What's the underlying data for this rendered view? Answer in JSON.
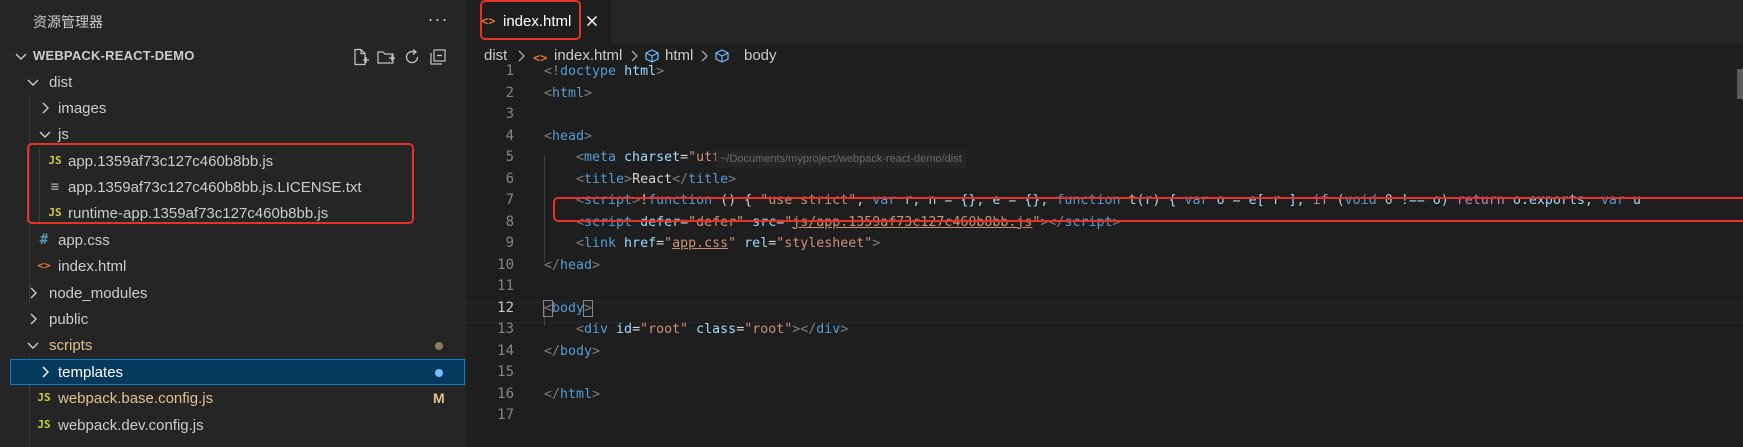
{
  "sidebar": {
    "title": "资源管理器",
    "more_label": "···",
    "section": "WEBPACK-REACT-DEMO",
    "tree": [
      {
        "name": "dist",
        "type": "folder",
        "expanded": true,
        "color": "#cccccc"
      },
      {
        "name": "images",
        "type": "folder",
        "expanded": false,
        "color": "#cccccc"
      },
      {
        "name": "js",
        "type": "folder",
        "expanded": true,
        "color": "#cccccc"
      },
      {
        "name": "app.1359af73c127c460b8bb.js",
        "type": "js",
        "icon": "JS",
        "color": "#cccccc"
      },
      {
        "name": "app.1359af73c127c460b8bb.js.LICENSE.txt",
        "type": "txt",
        "icon": "≡",
        "color": "#cccccc"
      },
      {
        "name": "runtime-app.1359af73c127c460b8bb.js",
        "type": "js",
        "icon": "JS",
        "color": "#cccccc"
      },
      {
        "name": "app.css",
        "type": "css",
        "icon": "#",
        "color": "#cccccc"
      },
      {
        "name": "index.html",
        "type": "html",
        "icon": "<>",
        "color": "#cccccc"
      },
      {
        "name": "node_modules",
        "type": "folder",
        "expanded": false,
        "color": "#cccccc"
      },
      {
        "name": "public",
        "type": "folder",
        "expanded": false,
        "color": "#cccccc"
      },
      {
        "name": "scripts",
        "type": "folder",
        "expanded": true,
        "color": "#e2c08d"
      },
      {
        "name": "templates",
        "type": "folder",
        "expanded": false,
        "color": "#ffffff"
      },
      {
        "name": "webpack.base.config.js",
        "type": "js",
        "icon": "JS",
        "color": "#e2c08d",
        "badge": "M"
      },
      {
        "name": "webpack.dev.config.js",
        "type": "js",
        "icon": "JS",
        "color": "#cccccc"
      }
    ]
  },
  "editor": {
    "tab_label": "index.html",
    "tab_icon": "<>",
    "breadcrumb": {
      "folder": "dist",
      "file": "index.html",
      "el1": "html",
      "el2": "body"
    },
    "path_hint": "~/Documents/myproject/webpack-react-demo/dist",
    "active_line": 12,
    "line_numbers": [
      "1",
      "2",
      "3",
      "4",
      "5",
      "6",
      "7",
      "8",
      "9",
      "10",
      "11",
      "12",
      "13",
      "14",
      "15",
      "16",
      "17"
    ],
    "code": {
      "l1": {
        "a": "<!",
        "b": "doctype",
        "c": " html",
        "d": ">"
      },
      "l2": {
        "a": "<",
        "b": "html",
        "c": ">"
      },
      "l4": {
        "a": "<",
        "b": "head",
        "c": ">"
      },
      "l5": {
        "a": "<",
        "b": "meta",
        "c": " charset",
        "d": "=",
        "e": "\"utf-8\"",
        "f": " />"
      },
      "l6": {
        "a": "<",
        "b": "title",
        "c": ">",
        "d": "React",
        "e": "</",
        "f": "title",
        "g": ">"
      },
      "l7": {
        "a": "<",
        "b": "script",
        "c": ">",
        "d": "!",
        "e": "function",
        "f": " () { ",
        "g": "\"use strict\"",
        "h": "; ",
        "i": "var",
        "j": " r, n = {}, e = {}; ",
        "k": "function",
        "l": " t",
        "m": "(r) { ",
        "n": "var",
        "o": " o = e[ r ]; ",
        "p": "if",
        "q": " (",
        "r": "void",
        "s": " 0",
        "t": " !== o) ",
        "u": "return",
        "v": " o.exports; ",
        "w": "var",
        "x": " u"
      },
      "l8": {
        "a": "<",
        "b": "script",
        "c": " defer",
        "d": "=",
        "e": "\"defer\"",
        "f": " src",
        "g": "=",
        "h": "\"",
        "i": "js/app.1359af73c127c460b8bb.js",
        "j": "\"",
        "k": "></",
        "l": "script",
        "m": ">"
      },
      "l9": {
        "a": "<",
        "b": "link",
        "c": " href",
        "d": "=",
        "e": "\"",
        "f": "app.css",
        "g": "\"",
        "h": " rel",
        "i": "=",
        "j": "\"stylesheet\"",
        "k": ">"
      },
      "l10": {
        "a": "</",
        "b": "head",
        "c": ">"
      },
      "l12": {
        "a": "<",
        "b": "body",
        "c": ">"
      },
      "l13": {
        "a": "<",
        "b": "div",
        "c": " id",
        "d": "=",
        "e": "\"root\"",
        "f": " class",
        "g": "=",
        "h": "\"root\"",
        "i": "></",
        "j": "div",
        "k": ">"
      },
      "l14": {
        "a": "</",
        "b": "body",
        "c": ">"
      },
      "l16": {
        "a": "</",
        "b": "html",
        "c": ">"
      }
    }
  },
  "colors": {
    "annotation": "#e5332a",
    "modified": "#e2c08d",
    "js_icon": "#cbcb41",
    "html_icon": "#e37933",
    "css_icon": "#519aba",
    "selection": "#04395e"
  }
}
